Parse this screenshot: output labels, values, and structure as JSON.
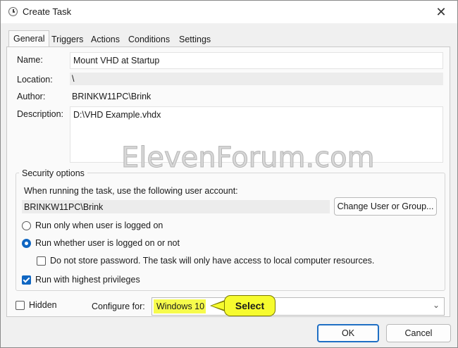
{
  "window": {
    "title": "Create Task"
  },
  "tabs": [
    {
      "label": "General",
      "active": true
    },
    {
      "label": "Triggers"
    },
    {
      "label": "Actions"
    },
    {
      "label": "Conditions"
    },
    {
      "label": "Settings"
    }
  ],
  "general": {
    "name_label": "Name:",
    "name_value": "Mount VHD at Startup",
    "location_label": "Location:",
    "location_value": "\\",
    "author_label": "Author:",
    "author_value": "BRINKW11PC\\Brink",
    "description_label": "Description:",
    "description_value": "D:\\VHD Example.vhdx"
  },
  "watermark": "ElevenForum.com",
  "security": {
    "group_title": "Security options",
    "account_prompt": "When running the task, use the following user account:",
    "account_value": "BRINKW11PC\\Brink",
    "change_button": "Change User or Group...",
    "radio_logged_on": "Run only when user is logged on",
    "radio_whether": "Run whether user is logged on or not",
    "radio_selected": "whether",
    "no_store_password": "Do not store password.  The task will only have access to local computer resources.",
    "no_store_password_checked": false,
    "highest_privileges": "Run with highest privileges",
    "highest_privileges_checked": true
  },
  "bottom": {
    "hidden_label": "Hidden",
    "hidden_checked": false,
    "configure_label": "Configure for:",
    "configure_value": "Windows 10",
    "callout_text": "Select"
  },
  "buttons": {
    "ok": "OK",
    "cancel": "Cancel"
  },
  "colors": {
    "accent": "#0f66c2",
    "highlight": "#f6fb4c"
  }
}
